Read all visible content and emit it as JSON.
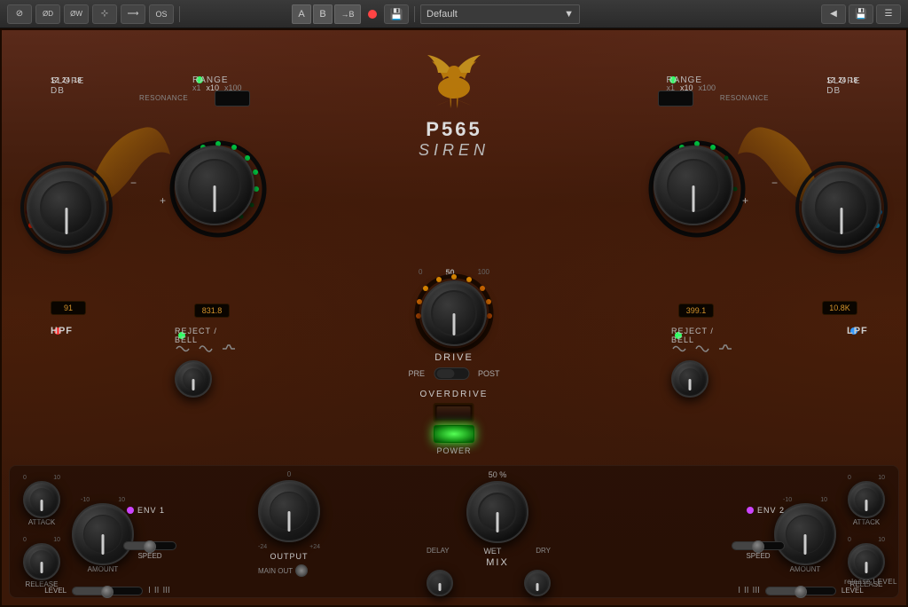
{
  "toolbar": {
    "icons": [
      "⊘",
      "⊘D",
      "⊘W",
      "⊹",
      "⟶",
      "OS"
    ],
    "ab_buttons": [
      "A",
      "B",
      "→B"
    ],
    "preset_name": "Default",
    "save_icon": "💾",
    "menu_icon": "☰"
  },
  "plugin": {
    "name": "P565",
    "subtitle": "SIREN"
  },
  "left_filter": {
    "slope_db_label": "SLOPE dB",
    "slope_options": [
      "12",
      "24",
      "18"
    ],
    "resonance_label": "RESONANCE",
    "range_label": "RANGE",
    "range_options": [
      "x1",
      "x10",
      "x100"
    ],
    "range_led": "green",
    "hpf_label": "HPF",
    "hpf_dot": "red",
    "freq_value": "91",
    "freq_knob_value": "831.8",
    "reject_bell_label": "REJECT / BELL"
  },
  "right_filter": {
    "slope_db_label": "SLOPE dB",
    "slope_options": [
      "12",
      "24",
      "18"
    ],
    "resonance_label": "RESONANCE",
    "range_label": "RANGE",
    "range_options": [
      "x1",
      "x10",
      "x100"
    ],
    "range_led": "green",
    "lpf_label": "LPF",
    "lpf_dot": "blue",
    "freq_value": "10.8K",
    "freq_knob_value": "399.1",
    "reject_bell_label": "REJECT / BELL"
  },
  "drive": {
    "label": "DRIVE",
    "value": 50,
    "min": 0,
    "max": 100,
    "pre_label": "PRE",
    "post_label": "POST"
  },
  "overdrive": {
    "label": "OVERDRIVE",
    "power_label": "POWER"
  },
  "left_env": {
    "label": "ENV 1",
    "dot_color": "purple",
    "attack_label": "ATTACK",
    "release_label": "RELEASE",
    "amount_label": "AMOUNT",
    "speed_label": "SPEED",
    "level_label": "LEVEL",
    "attack_range": [
      "0",
      "10"
    ],
    "release_range": [
      "0",
      "10"
    ],
    "amount_range": [
      "-10",
      "10"
    ]
  },
  "right_env": {
    "label": "ENV 2",
    "dot_color": "purple",
    "attack_label": "ATTACK",
    "release_label": "RELEASE",
    "amount_label": "AMOUNT",
    "speed_label": "SPEED",
    "level_label": "LEVEL"
  },
  "output": {
    "label": "OUTPUT",
    "range_min": "-24",
    "range_max": "+24",
    "main_out_label": "MAIN OUT"
  },
  "mix": {
    "label": "MIX",
    "percent_label": "50 %",
    "delay_label": "DELAY",
    "wet_label": "WET",
    "dry_label": "DRY"
  },
  "release_level": {
    "label": "release LEVEL"
  }
}
